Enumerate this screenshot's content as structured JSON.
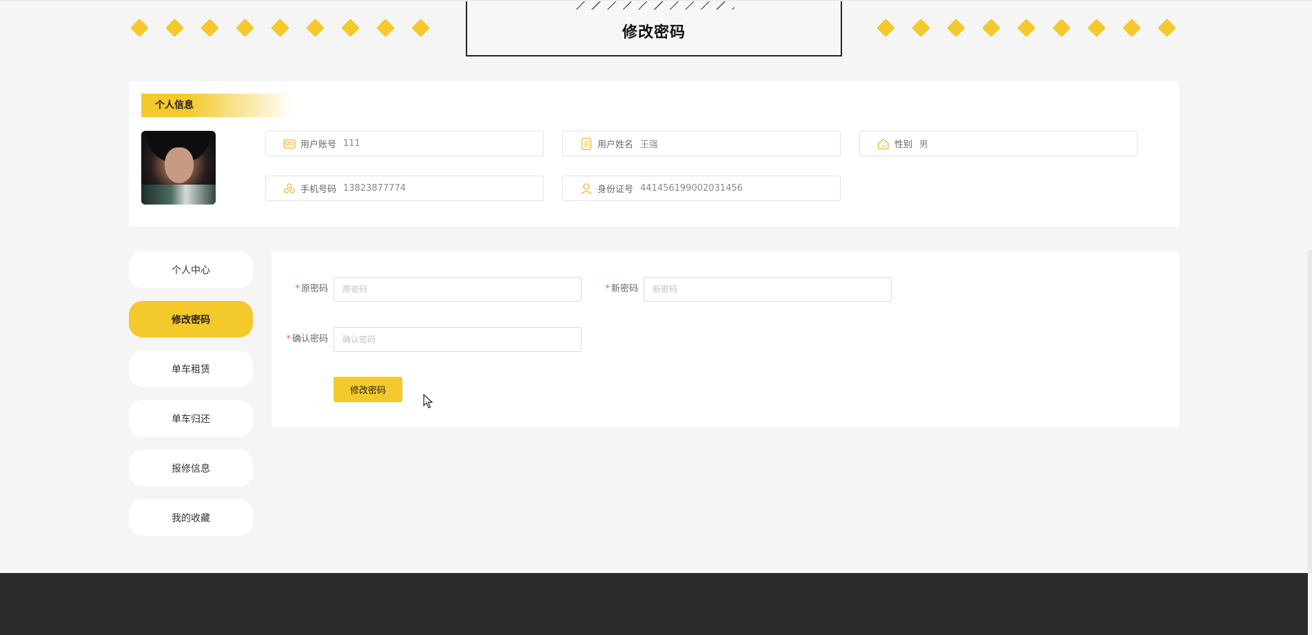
{
  "page": {
    "title": "修改密码"
  },
  "profile": {
    "section_title": "个人信息",
    "fields": [
      {
        "label": "用户账号",
        "value": "111",
        "icon": "id-card-icon"
      },
      {
        "label": "用户姓名",
        "value": "王强",
        "icon": "document-icon"
      },
      {
        "label": "性别",
        "value": "男",
        "icon": "home-icon"
      },
      {
        "label": "手机号码",
        "value": "13823877774",
        "icon": "phone-icon"
      },
      {
        "label": "身份证号",
        "value": "441456199002031456",
        "icon": "user-icon"
      }
    ]
  },
  "sidebar": {
    "items": [
      {
        "label": "个人中心"
      },
      {
        "label": "修改密码",
        "active": true
      },
      {
        "label": "单车租赁"
      },
      {
        "label": "单车归还"
      },
      {
        "label": "报修信息"
      },
      {
        "label": "我的收藏"
      }
    ]
  },
  "form": {
    "old_password": {
      "label": "原密码",
      "placeholder": "原密码",
      "value": ""
    },
    "new_password": {
      "label": "新密码",
      "placeholder": "新密码",
      "value": ""
    },
    "confirm_password": {
      "label": "确认密码",
      "placeholder": "确认密码",
      "value": ""
    },
    "required_mark": "*",
    "submit_label": "修改密码"
  },
  "colors": {
    "accent": "#f3c92b",
    "footer": "#2b2b2b",
    "background": "#f5f5f5"
  }
}
